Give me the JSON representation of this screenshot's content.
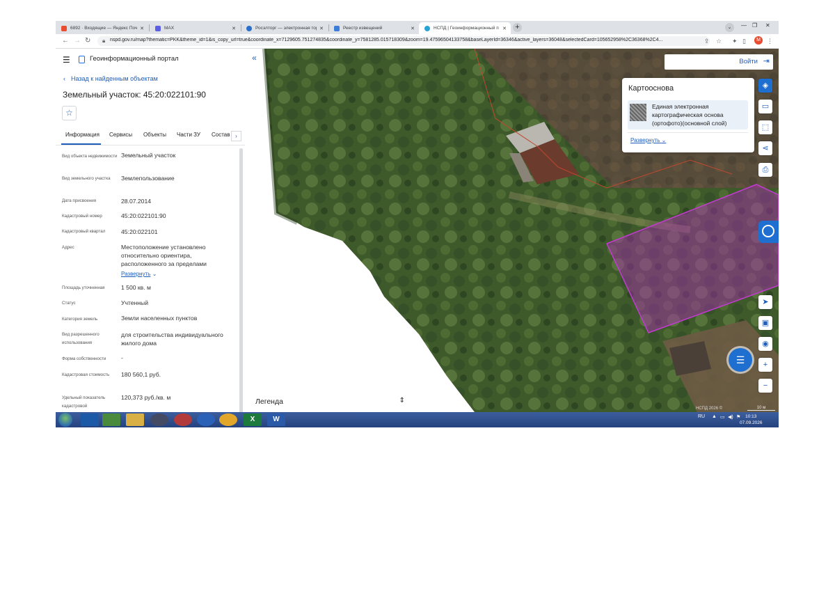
{
  "browser": {
    "tabs": [
      {
        "title": "6892 · Входящие — Яндекс Поч",
        "color": "#e94c2e"
      },
      {
        "title": "MAX",
        "color": "#5b5fe3"
      },
      {
        "title": "Росэлторг — электронная торг",
        "color": "#2a6fc9"
      },
      {
        "title": "Реестр извещений",
        "color": "#3b7dd8"
      },
      {
        "title": "НСПД | Геоинформационный п",
        "color": "#29a3d6"
      }
    ],
    "new_tab": "+",
    "url": "nspd.gov.ru/map?thematic=PKK&theme_id=1&is_copy_url=true&coordinate_x=7129605.751274835&coordinate_y=7581285.015718309&zoom=19.47596504133758&baseLayerId=36346&active_layers=36048&selectedCard=105652958%2C36368%2C4...",
    "profile_letter": "M"
  },
  "portal": {
    "title": "Геоинформационный портал",
    "back_link": "Назад к найденным объектам",
    "object_title": "Земельный участок: 45:20:022101:90",
    "tabs": [
      "Информация",
      "Сервисы",
      "Объекты",
      "Части ЗУ",
      "Состав"
    ],
    "expand_label": "Развернуть",
    "fields": [
      {
        "label": "Вид объекта недвижимости",
        "value": "Земельный участок"
      },
      {
        "label": "Вид земельного участка",
        "value": "Землепользование"
      },
      {
        "label": "Дата присвоения",
        "value": "28.07.2014"
      },
      {
        "label": "Кадастровый номер",
        "value": "45:20:022101:90"
      },
      {
        "label": "Кадастровый квартал",
        "value": "45:20:022101"
      },
      {
        "label": "Адрес",
        "value": "Местоположение установлено относительно ориентира, расположенного за пределами"
      },
      {
        "label": "Площадь уточненная",
        "value": "1 500 кв. м"
      },
      {
        "label": "Статус",
        "value": "Учтенный"
      },
      {
        "label": "Категория земель",
        "value": "Земли населенных пунктов"
      },
      {
        "label": "Вид разрешенного использования",
        "value": "для строительства индивидуального жилого дома"
      },
      {
        "label": "Форма собственности",
        "value": "-"
      },
      {
        "label": "Кадастровая стоимость",
        "value": "180 560,1 руб."
      },
      {
        "label": "Удельный показатель кадастровой",
        "value": "120,373 руб./кв. м"
      }
    ]
  },
  "map": {
    "login_label": "Войти",
    "basemap_title": "Картооснова",
    "basemap_item": "Единая электронная картографическая основа (ортофото)(основной слой)",
    "basemap_expand": "Развернуть",
    "legend_label": "Легенда",
    "attribution": "НСПД 2026 ©",
    "scale_label": "10 м",
    "parcel_color": "#b02ab8",
    "boundary_color": "#c0482e"
  },
  "taskbar": {
    "apps": [
      {
        "name": "explorer",
        "label": "",
        "color": "#1c5aa8"
      },
      {
        "name": "notes",
        "label": "",
        "color": "#4a8a3c"
      },
      {
        "name": "folder",
        "label": "",
        "color": "#d8b046"
      },
      {
        "name": "app-a",
        "label": "",
        "color": "#444a63"
      },
      {
        "name": "app-b",
        "label": "",
        "color": "#b33a3a"
      },
      {
        "name": "app-c",
        "label": "",
        "color": "#2b62b8"
      },
      {
        "name": "chrome",
        "label": "",
        "color": "#e2a72a"
      },
      {
        "name": "excel",
        "label": "X",
        "color": "#1d7a3d"
      },
      {
        "name": "word",
        "label": "W",
        "color": "#2b5aa8"
      }
    ],
    "lang": "RU",
    "time": "10:13",
    "date": "07.09.2026"
  }
}
